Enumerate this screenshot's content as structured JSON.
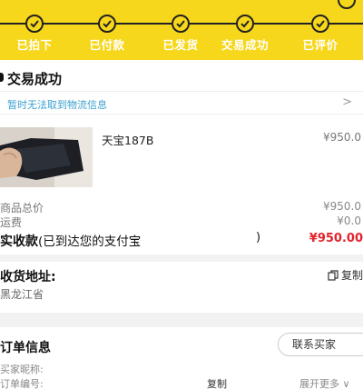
{
  "progress": {
    "steps": [
      "已拍下",
      "已付款",
      "已发货",
      "交易成功",
      "已评价"
    ]
  },
  "status": {
    "title": "交易成功",
    "logistics_text": "暂时无法取到物流信息",
    "logistics_arrow": ">"
  },
  "product": {
    "name": "天宝187B",
    "price": "¥950.0"
  },
  "summary": {
    "total_label": "商品总价",
    "total_value": "¥950.0",
    "shipping_label": "运费",
    "shipping_value": "¥0.0",
    "paid_label": "实收款",
    "paid_note": "(已到达您的支付宝",
    "paid_paren": ")",
    "paid_value": "¥950.00"
  },
  "address": {
    "title": "收货地址:",
    "text": "黑龙江省",
    "copy_label": "复制"
  },
  "order": {
    "title": "订单信息",
    "contact_button": "联系买家",
    "buyer_nick_label": "买家昵称:",
    "order_no_label": "订单编号:",
    "copy_label": "复制",
    "expand_label": "展开更多 ∨"
  },
  "colors": {
    "header_yellow": "#f7d71b",
    "price_red": "#e3232c",
    "link_blue": "#3aa0cf"
  }
}
